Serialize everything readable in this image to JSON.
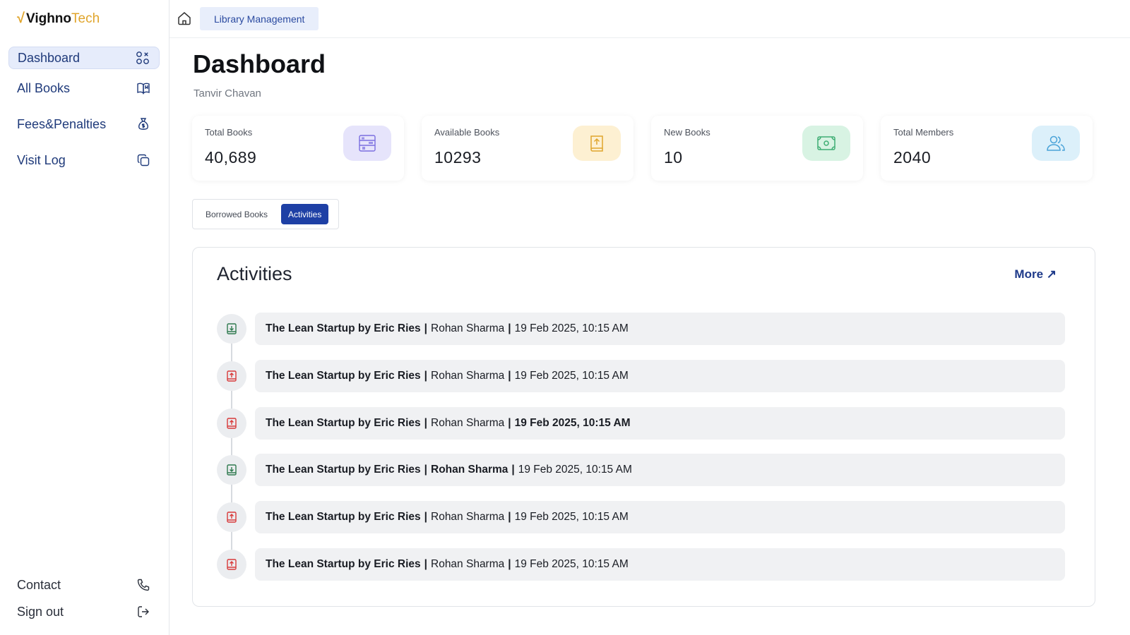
{
  "brand": {
    "part1": "Vighno",
    "part2": "Tech",
    "mark": "√"
  },
  "sidebar": {
    "items": [
      {
        "label": "Dashboard",
        "icon": "grid-icon",
        "active": true
      },
      {
        "label": "All Books",
        "icon": "book-open-icon"
      },
      {
        "label": "Fees&Penalties",
        "icon": "money-bag-icon"
      },
      {
        "label": "Visit Log",
        "icon": "copy-icon"
      }
    ],
    "bottom": [
      {
        "label": "Contact",
        "icon": "phone-icon"
      },
      {
        "label": "Sign out",
        "icon": "sign-out-icon"
      }
    ]
  },
  "topbar": {
    "breadcrumb": "Library Management",
    "home_icon": "home-icon"
  },
  "page": {
    "title": "Dashboard",
    "user": "Tanvir Chavan"
  },
  "stats": [
    {
      "label": "Total Books",
      "value": "40,689",
      "icon": "bookshelf-icon",
      "bg": "#e6e4fb",
      "fg": "#7b6ee0"
    },
    {
      "label": "Available Books",
      "value": "10293",
      "icon": "book-upload-icon",
      "bg": "#fdf0d2",
      "fg": "#e0a52c"
    },
    {
      "label": "New Books",
      "value": "10",
      "icon": "cash-icon",
      "bg": "#d8f3e3",
      "fg": "#3fae74"
    },
    {
      "label": "Total Members",
      "value": "2040",
      "icon": "users-icon",
      "bg": "#dcf0fa",
      "fg": "#4aa3d8"
    }
  ],
  "tabs": [
    {
      "label": "Borrowed Books",
      "active": false
    },
    {
      "label": "Activities",
      "active": true
    }
  ],
  "activities": {
    "title": "Activities",
    "more_label": "More ↗",
    "items": [
      {
        "type": "download",
        "book": "The Lean Startup by Eric Ries",
        "member": "Rohan Sharma",
        "time": "19 Feb 2025, 10:15 AM",
        "member_bold": false,
        "time_bold": false
      },
      {
        "type": "upload",
        "book": "The Lean Startup by Eric Ries",
        "member": "Rohan Sharma",
        "time": "19 Feb 2025, 10:15 AM",
        "member_bold": false,
        "time_bold": false
      },
      {
        "type": "upload",
        "book": "The Lean Startup by Eric Ries",
        "member": "Rohan Sharma",
        "time": "19 Feb 2025, 10:15 AM",
        "member_bold": false,
        "time_bold": true
      },
      {
        "type": "download",
        "book": "The Lean Startup by Eric Ries",
        "member": "Rohan Sharma",
        "time": "19 Feb 2025, 10:15 AM",
        "member_bold": true,
        "time_bold": false
      },
      {
        "type": "upload",
        "book": "The Lean Startup by Eric Ries",
        "member": "Rohan Sharma",
        "time": "19 Feb 2025, 10:15 AM",
        "member_bold": false,
        "time_bold": false
      },
      {
        "type": "upload",
        "book": "The Lean Startup by Eric Ries",
        "member": "Rohan Sharma",
        "time": "19 Feb 2025, 10:15 AM",
        "member_bold": false,
        "time_bold": false
      }
    ]
  },
  "colors": {
    "accent": "#1e40a5",
    "nav_text": "#1f3a7a",
    "download": "#2f7a4f",
    "upload": "#d83a3a"
  }
}
